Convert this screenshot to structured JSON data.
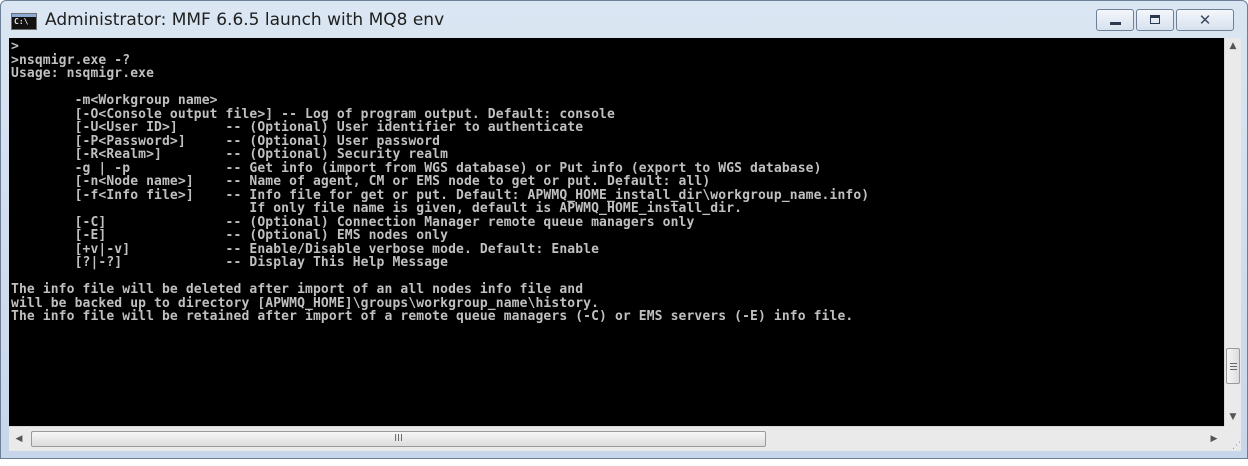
{
  "window": {
    "title": "Administrator:  MMF 6.6.5 launch with MQ8 env",
    "icon": "cmd-console-icon",
    "icon_text": "C:\\",
    "controls": {
      "minimize": "minimize-icon",
      "maximize": "maximize-icon",
      "close": "close-icon",
      "close_glyph": "✕"
    }
  },
  "console": {
    "background": "#000000",
    "foreground": "#c0c0c0",
    "lines": [
      ">",
      ">nsqmigr.exe -?",
      "Usage: nsqmigr.exe",
      "",
      "        -m<Workgroup name>",
      "        [-O<Console output file>] -- Log of program output. Default: console",
      "        [-U<User ID>]      -- (Optional) User identifier to authenticate",
      "        [-P<Password>]     -- (Optional) User password",
      "        [-R<Realm>]        -- (Optional) Security realm",
      "        -g | -p            -- Get info (import from WGS database) or Put info (export to WGS database)",
      "        [-n<Node name>]    -- Name of agent, CM or EMS node to get or put. Default: all)",
      "        [-f<Info file>]    -- Info file for get or put. Default: APWMQ_HOME_install_dir\\workgroup_name.info)",
      "                              If only file name is given, default is APWMQ_HOME_install_dir.",
      "        [-C]               -- (Optional) Connection Manager remote queue managers only",
      "        [-E]               -- (Optional) EMS nodes only",
      "        [+v|-v]            -- Enable/Disable verbose mode. Default: Enable",
      "        [?|-?]             -- Display This Help Message",
      "",
      "The info file will be deleted after import of an all nodes info file and",
      "will be backed up to directory [APWMQ_HOME]\\groups\\workgroup_name\\history.",
      "The info file will be retained after import of a remote queue managers (-C) or EMS servers (-E) info file."
    ]
  },
  "scrollbars": {
    "vertical": {
      "up_arrow": "▲",
      "down_arrow": "▼",
      "position": 0.92
    },
    "horizontal": {
      "left_arrow": "◀",
      "right_arrow": "▶",
      "thumb_grip": "III",
      "position": 0.0
    }
  },
  "resize_grip_glyph": "⋰"
}
